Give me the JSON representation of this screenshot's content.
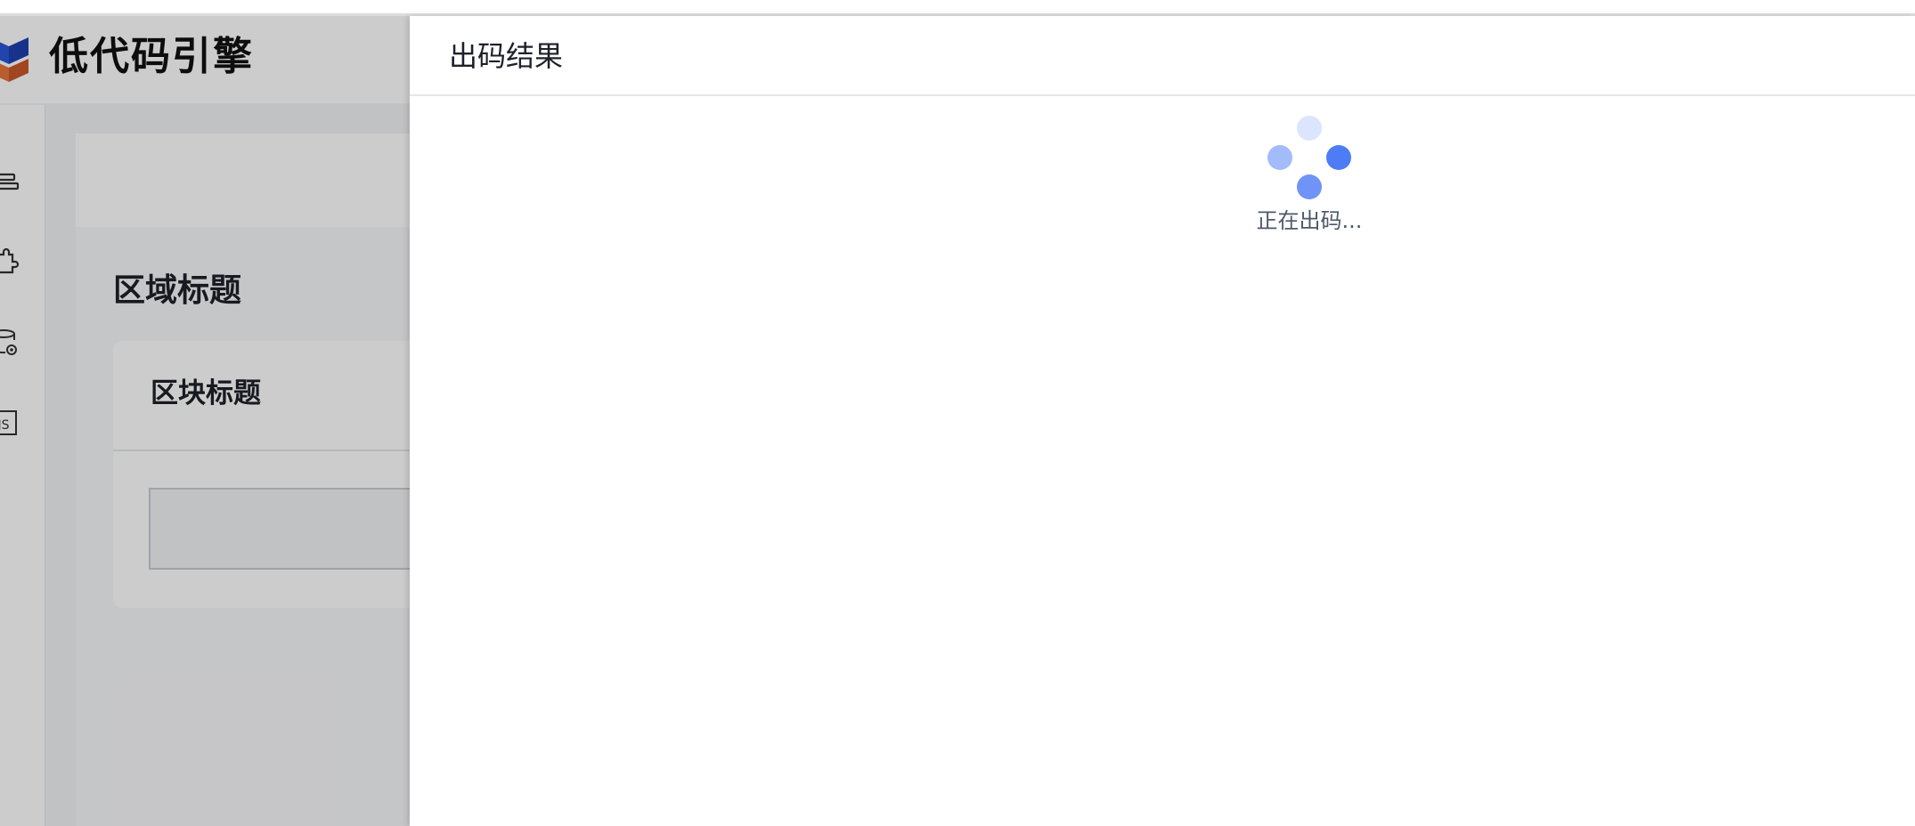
{
  "app": {
    "brand_title": "低代码引擎"
  },
  "canvas": {
    "region_title": "区域标题",
    "block_title": "区块标题"
  },
  "drawer": {
    "title": "出码结果",
    "loading_text": "正在出码..."
  },
  "icons": {
    "logo": "logo-icon",
    "outline": "outline-icon",
    "components": "puzzle-icon",
    "datasource": "database-settings-icon",
    "code": "js-code-icon",
    "spinner": "loading-spinner-icon"
  },
  "colors": {
    "accent": "#4d7cf4",
    "mask": "rgba(0,0,0,0.2)"
  }
}
